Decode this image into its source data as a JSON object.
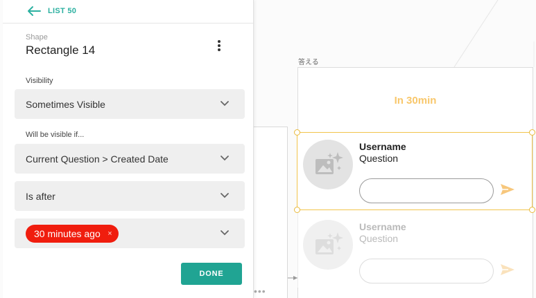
{
  "nav": {
    "back_label": "LIST 50"
  },
  "shape": {
    "caption": "Shape",
    "title": "Rectangle 14"
  },
  "visibility": {
    "label": "Visibility",
    "selected": "Sometimes Visible"
  },
  "condition": {
    "label": "Will be visible if...",
    "field": "Current Question > Created Date",
    "operator": "Is after",
    "value_tag": "30 minutes ago",
    "tag_remove": "×"
  },
  "actions": {
    "done_label": "DONE"
  },
  "canvas": {
    "screen_label": "答える",
    "header_text": "In 30min",
    "rows": [
      {
        "username": "Username",
        "question": "Question"
      },
      {
        "username": "Username",
        "question": "Question"
      }
    ]
  },
  "icons": {
    "back": "arrow-left-icon",
    "more": "more-vertical-icon",
    "chevron": "chevron-down-icon",
    "image": "image-placeholder-icon",
    "send": "send-icon"
  },
  "colors": {
    "accent_teal": "#20a493",
    "tag_red": "#f01d0e",
    "selection_yellow": "#f2c44a",
    "header_text": "#f8c76b"
  }
}
